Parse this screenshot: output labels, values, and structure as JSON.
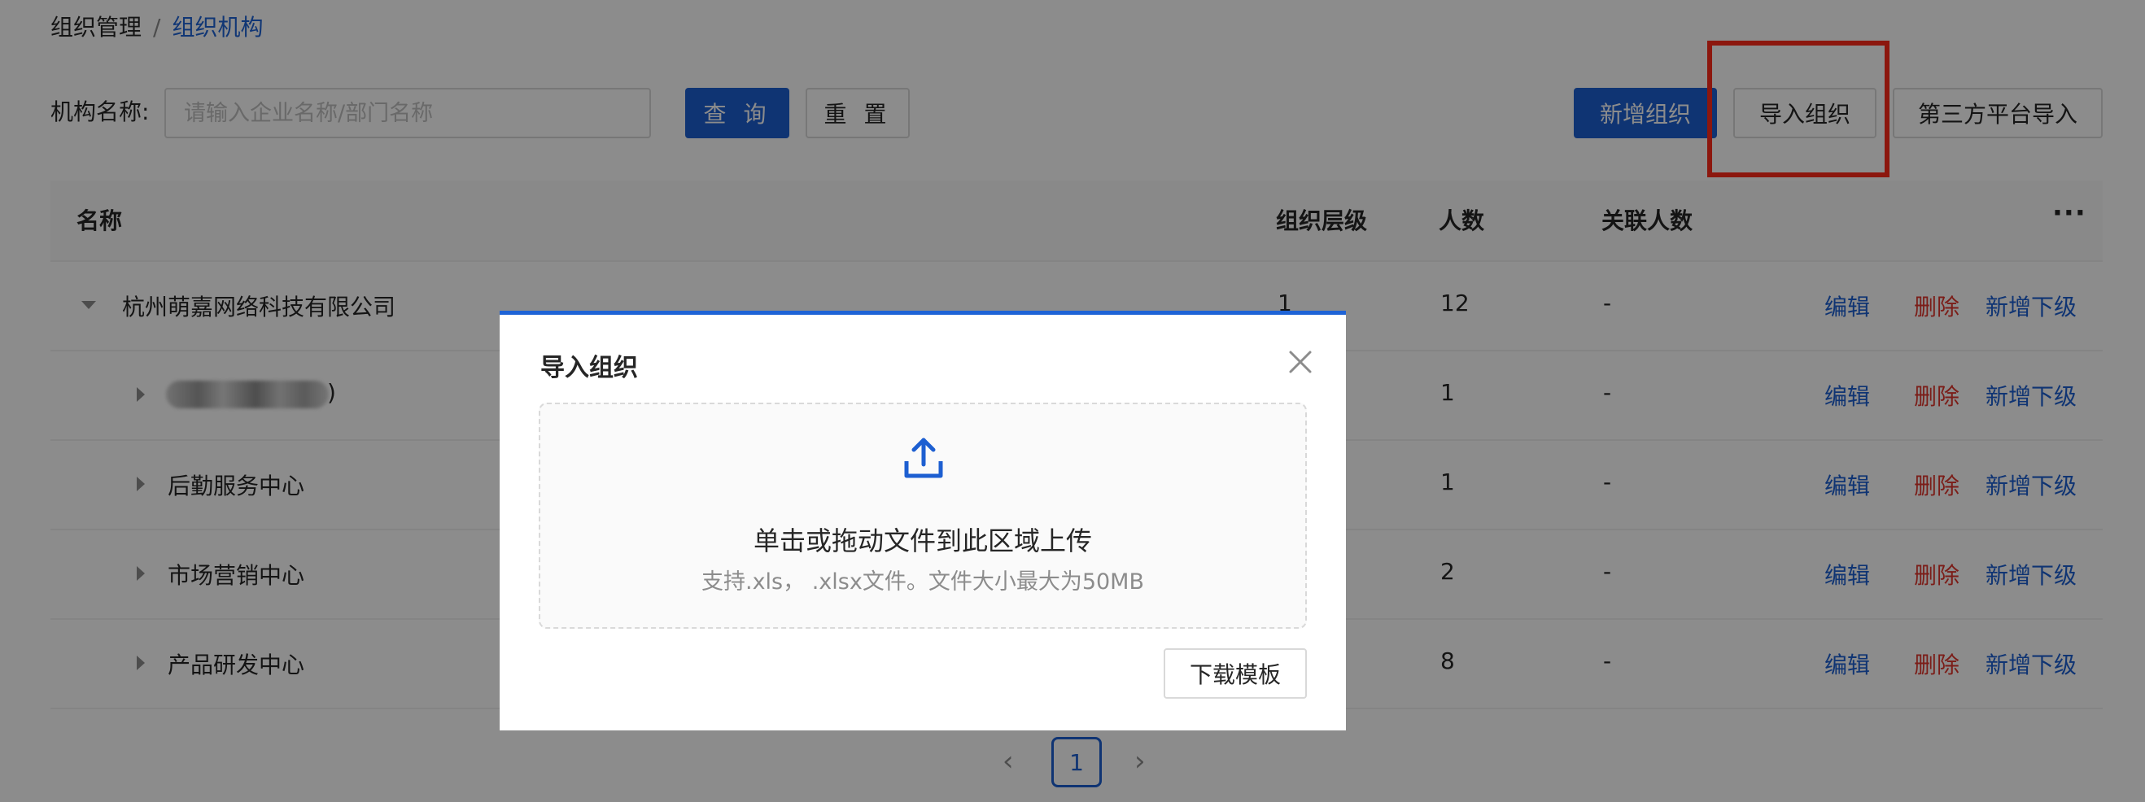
{
  "breadcrumb": {
    "parent": "组织管理",
    "separator": "/",
    "current": "组织机构"
  },
  "search": {
    "label": "机构名称:",
    "placeholder": "请输入企业名称/部门名称",
    "value": ""
  },
  "buttons": {
    "query": "查 询",
    "reset": "重 置",
    "add_org": "新增组织",
    "import_org": "导入组织",
    "third_party": "第三方平台导入"
  },
  "table": {
    "columns": {
      "name": "名称",
      "level": "组织层级",
      "count": "人数",
      "linked": "关联人数",
      "more": "···"
    },
    "actions": {
      "edit": "编辑",
      "delete": "删除",
      "add_child": "新增下级"
    },
    "rows": [
      {
        "name": "杭州萌嘉网络科技有限公司",
        "level": "1",
        "count": "12",
        "linked": "-",
        "expanded": true
      },
      {
        "name": ")",
        "level": "",
        "count": "1",
        "linked": "-",
        "expanded": false,
        "name_blurred": true
      },
      {
        "name": "后勤服务中心",
        "level": "",
        "count": "1",
        "linked": "-",
        "expanded": false
      },
      {
        "name": "市场营销中心",
        "level": "",
        "count": "2",
        "linked": "-",
        "expanded": false
      },
      {
        "name": "产品研发中心",
        "level": "",
        "count": "8",
        "linked": "-",
        "expanded": false
      }
    ]
  },
  "pagination": {
    "prev": "‹",
    "current_page": "1",
    "next": "›"
  },
  "modal": {
    "title": "导入组织",
    "drop_main": "单击或拖动文件到此区域上传",
    "drop_sub": "支持.xls， .xlsx文件。文件大小最大为50MB",
    "download_template": "下载模板"
  },
  "colors": {
    "primary": "#1d5fd1",
    "danger": "#e0362c",
    "highlight": "#ff2a1a"
  },
  "icons": {
    "close": "close-icon",
    "upload": "upload-icon",
    "caret_down": "caret-down-icon",
    "caret_right": "caret-right-icon"
  }
}
